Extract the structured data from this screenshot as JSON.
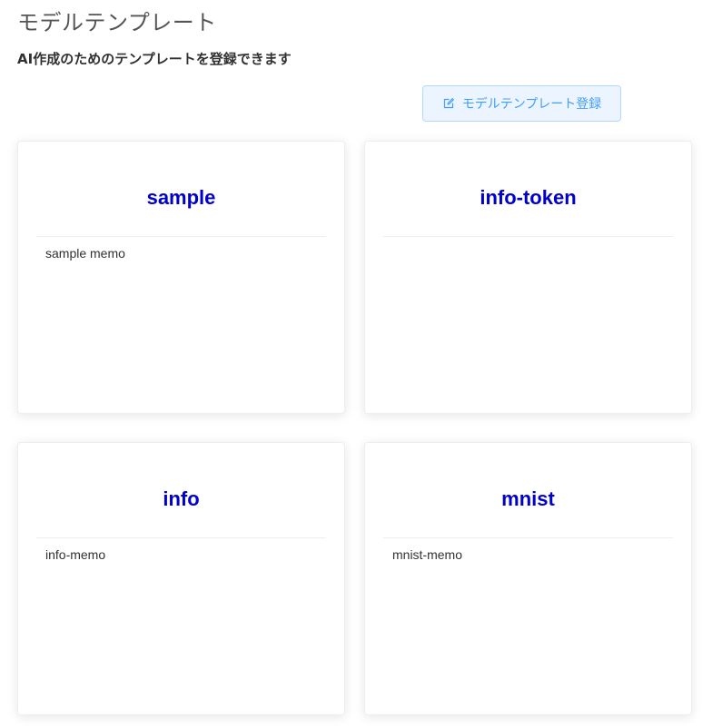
{
  "header": {
    "title": "モデルテンプレート",
    "subtitle": "AI作成のためのテンプレートを登録できます"
  },
  "toolbar": {
    "register_label": "モデルテンプレート登録",
    "register_icon": "edit-icon"
  },
  "templates": [
    {
      "name": "sample",
      "memo": "sample memo"
    },
    {
      "name": "info-token",
      "memo": ""
    },
    {
      "name": "info",
      "memo": "info-memo"
    },
    {
      "name": "mnist",
      "memo": "mnist-memo"
    }
  ],
  "colors": {
    "title": "#555555",
    "card_title": "#0000cd",
    "button_bg": "#ecf5ff",
    "button_border": "#b3d8ff",
    "button_text": "#409eff"
  }
}
